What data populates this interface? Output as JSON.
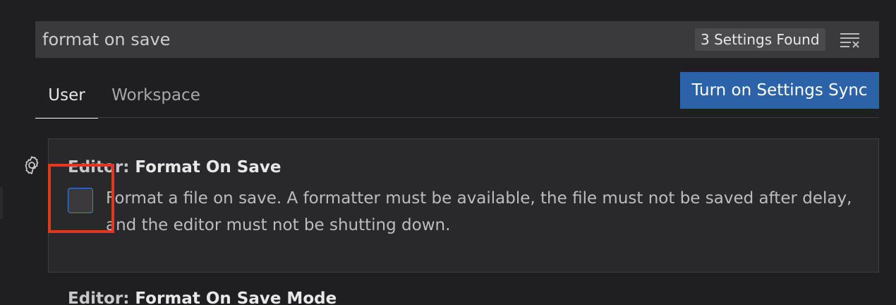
{
  "search": {
    "value": "format on save",
    "results_count": "3 Settings Found",
    "clear_icon": "clear-filter-icon"
  },
  "tabs": [
    {
      "label": "User",
      "active": true
    },
    {
      "label": "Workspace",
      "active": false
    }
  ],
  "sync_button": {
    "label": "Turn on Settings Sync"
  },
  "settings": [
    {
      "category": "Editor: ",
      "name": "Format On Save",
      "checked": false,
      "description": "Format a file on save. A formatter must be available, the file must not be saved after delay, and the editor must not be shutting down."
    },
    {
      "category": "Editor: ",
      "name": "Format On Save Mode"
    }
  ],
  "icons": {
    "gear": "gear-icon",
    "clear": "clear-filter-icon"
  },
  "colors": {
    "background": "#1f1f21",
    "accent_button": "#2c62a8",
    "checkbox_border": "#3f7fdc",
    "highlight": "#e0391f"
  }
}
